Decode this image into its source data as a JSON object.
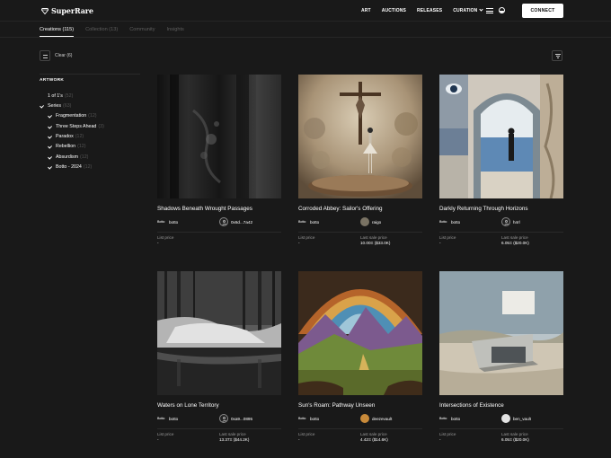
{
  "brand": {
    "name": "SuperRare",
    "logo_icon": "superrare-diamond-icon"
  },
  "nav": {
    "items": [
      {
        "label": "ART"
      },
      {
        "label": "AUCTIONS"
      },
      {
        "label": "RELEASES"
      },
      {
        "label": "CURATION"
      }
    ],
    "connect_label": "CONNECT",
    "menu_icon": "hamburger-menu-icon",
    "theme_icon": "theme-toggle-icon"
  },
  "tabs": [
    {
      "label": "Creations (115)",
      "active": true
    },
    {
      "label": "Collection (13)",
      "active": false
    },
    {
      "label": "Community",
      "active": false
    },
    {
      "label": "Insights",
      "active": false
    }
  ],
  "filters": {
    "clear_label": "Clear (6)",
    "heading": "ARTWORK",
    "items": [
      {
        "label": "1 of 1's",
        "count": "(52)",
        "checked": false
      },
      {
        "label": "Series",
        "count": "(63)",
        "checked": true
      },
      {
        "label": "Fragmentation",
        "count": "(12)",
        "checked": true
      },
      {
        "label": "Three Steps Ahead",
        "count": "(3)",
        "checked": true
      },
      {
        "label": "Paradox",
        "count": "(12)",
        "checked": true
      },
      {
        "label": "Rebellion",
        "count": "(12)",
        "checked": true
      },
      {
        "label": "Absurdism",
        "count": "(12)",
        "checked": true
      },
      {
        "label": "Botto - 2024",
        "count": "(12)",
        "checked": true
      }
    ]
  },
  "cards": [
    {
      "title": "Shadows Beneath Wrought Passages",
      "creator": "botto",
      "owner": "0x6d...7a42",
      "list_price_label": "List price",
      "list_price": "-",
      "sale_label": "",
      "sale_price": ""
    },
    {
      "title": "Corroded Abbey: Sailor's Offering",
      "creator": "botto",
      "owner": "raigo",
      "list_price_label": "List price",
      "list_price": "-",
      "sale_label": "Last sale price",
      "sale_price": "10.00Ξ ($33.0K)"
    },
    {
      "title": "Darkly Returning Through Horizons",
      "creator": "botto",
      "owner": "h4rl",
      "list_price_label": "List price",
      "list_price": "-",
      "sale_label": "Last sale price",
      "sale_price": "6.05Ξ ($20.0K)"
    },
    {
      "title": "Waters on Lone Territory",
      "creator": "botto",
      "owner": "0xa9...0895",
      "list_price_label": "List price",
      "list_price": "-",
      "sale_label": "Last sale price",
      "sale_price": "13.37Ξ ($44.2K)"
    },
    {
      "title": "Sun's Roam: Pathway Unseen",
      "creator": "botto",
      "owner": "deezevault",
      "list_price_label": "List price",
      "list_price": "-",
      "sale_label": "Last sale price",
      "sale_price": "4.42Ξ ($14.6K)"
    },
    {
      "title": "Intersections of Existence",
      "creator": "botto",
      "owner": "ben_vault",
      "list_price_label": "List price",
      "list_price": "-",
      "sale_label": "Last sale price",
      "sale_price": "6.05Ξ ($20.0K)"
    }
  ],
  "creator_badge": "Botto"
}
